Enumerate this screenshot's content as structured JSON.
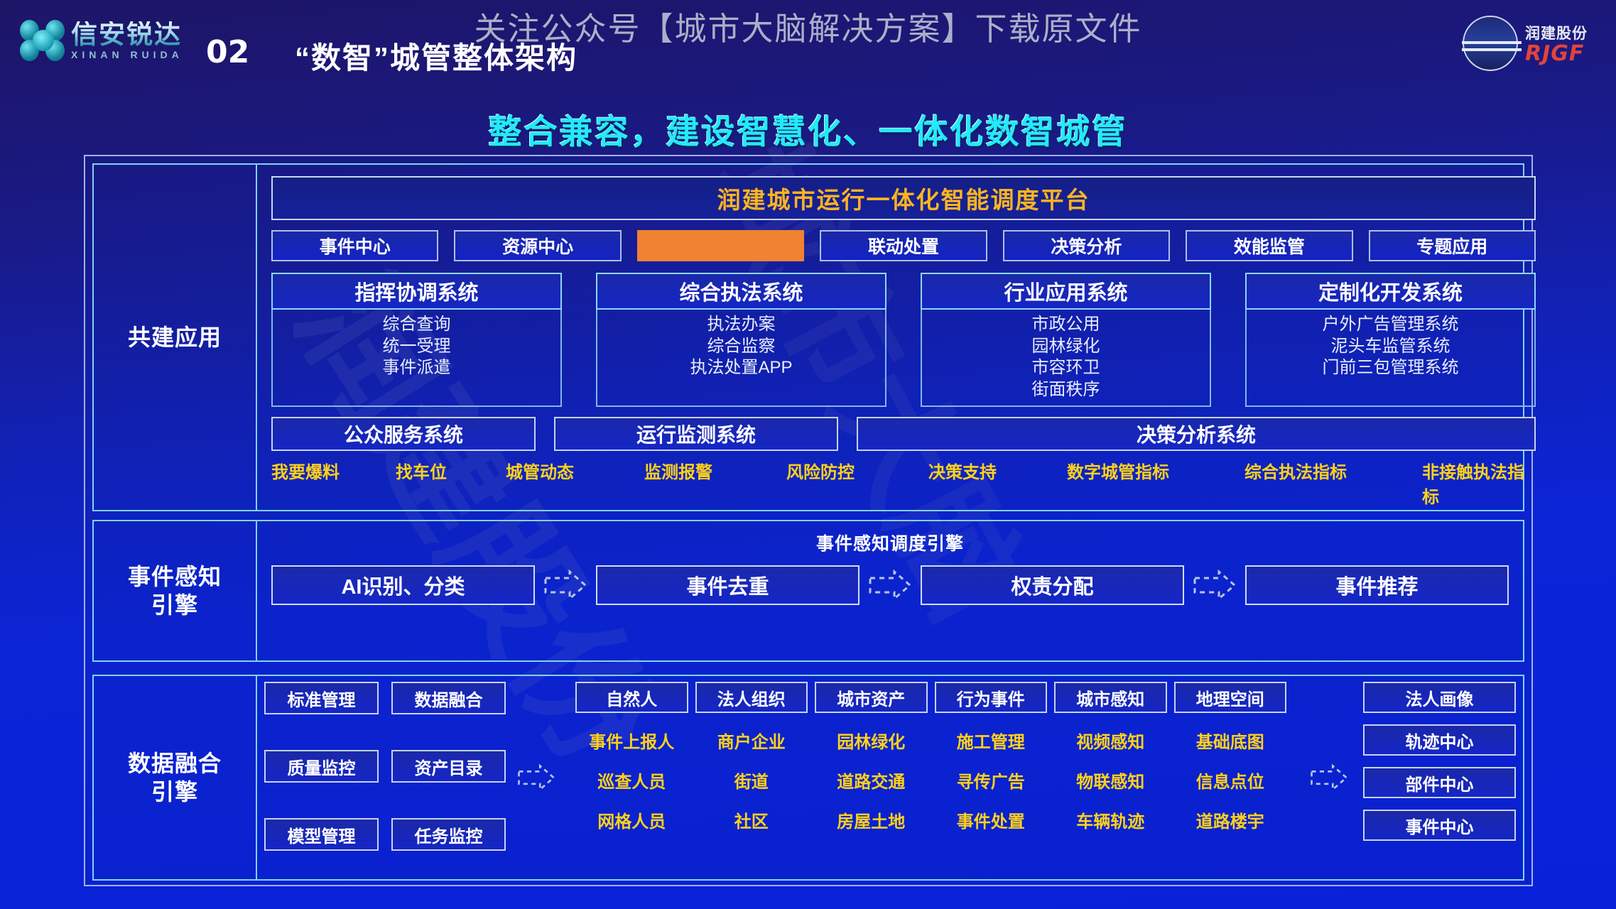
{
  "watermark": {
    "top_text": "关注公众号【城市大脑解决方案】下载原文件",
    "diagonal_text": "润建股份",
    "diagonal_text2": "城市大脑"
  },
  "header": {
    "brand_cn": "信安锐达",
    "brand_en": "XINAN RUIDA",
    "section_number": "02",
    "section_title": "“数智”城管整体架构",
    "partner_cn": "润建股份",
    "partner_en": "RJGF"
  },
  "slogan": "整合兼容，建设智慧化、一体化数智城管",
  "bands": {
    "app": {
      "label": "共建应用",
      "platform_bar": "润建城市运行一体化智能调度平台",
      "chips": [
        {
          "label": "事件中心",
          "highlighted": false
        },
        {
          "label": "资源中心",
          "highlighted": false
        },
        {
          "label": "",
          "highlighted": true
        },
        {
          "label": "联动处置",
          "highlighted": false
        },
        {
          "label": "决策分析",
          "highlighted": false
        },
        {
          "label": "效能监管",
          "highlighted": false
        },
        {
          "label": "专题应用",
          "highlighted": false
        }
      ],
      "systems": [
        {
          "title": "指挥协调系统",
          "items": "综合查询\n统一受理\n事件派遣"
        },
        {
          "title": "综合执法系统",
          "items": "执法办案\n综合监察\n执法处置APP"
        },
        {
          "title": "行业应用系统",
          "items": "市政公用\n园林绿化\n市容环卫\n街面秩序"
        },
        {
          "title": "定制化开发系统",
          "items": "户外广告管理系统\n泥头车监管系统\n门前三包管理系统"
        }
      ],
      "wide_boxes": [
        "公众服务系统",
        "运行监测系统",
        "决策分析系统"
      ],
      "yellow_items": [
        "我要爆料",
        "找车位",
        "城管动态",
        "监测报警",
        "风险防控",
        "决策支持",
        "数字城管指标",
        "综合执法指标",
        "非接触执法指标"
      ]
    },
    "sense": {
      "label": "事件感知\n引擎",
      "title": "事件感知调度引擎",
      "steps": [
        "AI识别、分类",
        "事件去重",
        "权责分配",
        "事件推荐"
      ]
    },
    "data": {
      "label": "数据融合\n引擎",
      "left_boxes": [
        "标准管理",
        "数据融合",
        "质量监控",
        "资产目录",
        "模型管理",
        "任务监控"
      ],
      "columns": [
        {
          "head": "自然人",
          "items": [
            "事件上报人",
            "巡查人员",
            "网格人员"
          ]
        },
        {
          "head": "法人组织",
          "items": [
            "商户企业",
            "街道",
            "社区"
          ]
        },
        {
          "head": "城市资产",
          "items": [
            "园林绿化",
            "道路交通",
            "房屋土地"
          ]
        },
        {
          "head": "行为事件",
          "items": [
            "施工管理",
            "寻传广告",
            "事件处置"
          ]
        },
        {
          "head": "城市感知",
          "items": [
            "视频感知",
            "物联感知",
            "车辆轨迹"
          ]
        },
        {
          "head": "地理空间",
          "items": [
            "基础底图",
            "信息点位",
            "道路楼宇"
          ]
        }
      ],
      "right_boxes": [
        "法人画像",
        "轨迹中心",
        "部件中心",
        "事件中心"
      ]
    }
  },
  "colors": {
    "background_top": "#1d1566",
    "background_bottom": "#0a21da",
    "slogan": "#24e9f8",
    "platform_title": "#ffb420",
    "highlight_chip": "#f08232",
    "yellow_text": "#ffd21a",
    "border_light": "#c9d6f2",
    "border_cyan": "#7fd4f2"
  }
}
